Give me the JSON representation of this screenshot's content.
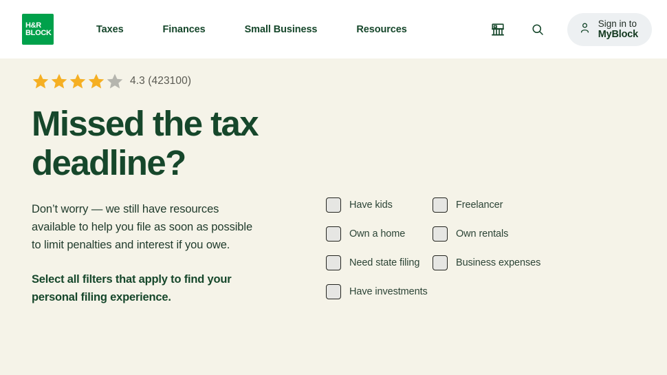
{
  "header": {
    "logo": {
      "line1": "H&R",
      "line2": "BLOCK",
      "color": "#00A14B"
    },
    "nav": [
      {
        "label": "Taxes",
        "name": "nav-item-taxes"
      },
      {
        "label": "Finances",
        "name": "nav-item-finances"
      },
      {
        "label": "Small Business",
        "name": "nav-item-small-business"
      },
      {
        "label": "Resources",
        "name": "nav-item-resources"
      }
    ],
    "office_icon": "office-building-icon",
    "search_icon": "search-icon",
    "signin": {
      "person_icon": "person-icon",
      "top_label": "Sign in to",
      "bottom_label": "MyBlock",
      "pill_color": "#EDF0F2"
    }
  },
  "hero": {
    "background_color": "#F5F3E8",
    "rating": {
      "value": "4.3",
      "count": "423100",
      "display_text": "4.3 (423100)",
      "stars_filled": 4,
      "stars_total": 5,
      "star_color": "#F5AF23",
      "star_empty_color": "#B5B5AE"
    },
    "headline": "Missed the tax deadline?",
    "headline_color": "#16472B",
    "paragraph": "Don’t worry — we still have resources available to help you file as soon as possible to limit penalties and interest if you owe.",
    "cta_text": "Select all filters that apply to find your personal filing experience.",
    "filters": {
      "left_column": [
        {
          "label": "Have kids",
          "name": "filter-have-kids",
          "checked": false
        },
        {
          "label": "Own a home",
          "name": "filter-own-a-home",
          "checked": false
        },
        {
          "label": "Need state filing",
          "name": "filter-need-state-filing",
          "checked": false
        },
        {
          "label": "Have investments",
          "name": "filter-have-investments",
          "checked": false
        }
      ],
      "right_column": [
        {
          "label": "Freelancer",
          "name": "filter-freelancer",
          "checked": false
        },
        {
          "label": "Own rentals",
          "name": "filter-own-rentals",
          "checked": false
        },
        {
          "label": "Business expenses",
          "name": "filter-business-expenses",
          "checked": false
        }
      ]
    }
  }
}
